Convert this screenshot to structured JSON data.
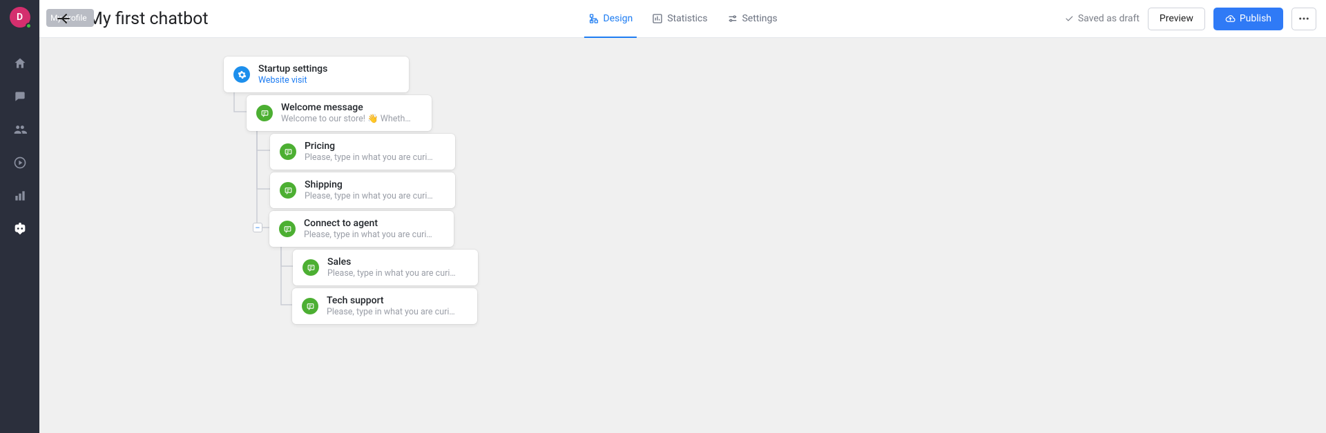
{
  "sidebar": {
    "avatarInitial": "D"
  },
  "header": {
    "backLabel": "My profile",
    "title": "My first chatbot",
    "tabs": {
      "design": "Design",
      "statistics": "Statistics",
      "settings": "Settings"
    },
    "savedStatus": "Saved as draft",
    "previewLabel": "Preview",
    "publishLabel": "Publish"
  },
  "nodes": {
    "startup": {
      "title": "Startup settings",
      "sub": "Website visit"
    },
    "welcome": {
      "title": "Welcome message",
      "sub": "Welcome to our store! 👋 Whether you hav…"
    },
    "pricing": {
      "title": "Pricing",
      "sub": "Please, type in what you are curious about."
    },
    "shipping": {
      "title": "Shipping",
      "sub": "Please, type in what you are curious about."
    },
    "connect": {
      "title": "Connect to agent",
      "sub": "Please, type in what you are curious about."
    },
    "sales": {
      "title": "Sales",
      "sub": "Please, type in what you are curious about."
    },
    "tech": {
      "title": "Tech support",
      "sub": "Please, type in what you are curious about."
    }
  },
  "handle": {
    "collapseGlyph": "–"
  }
}
